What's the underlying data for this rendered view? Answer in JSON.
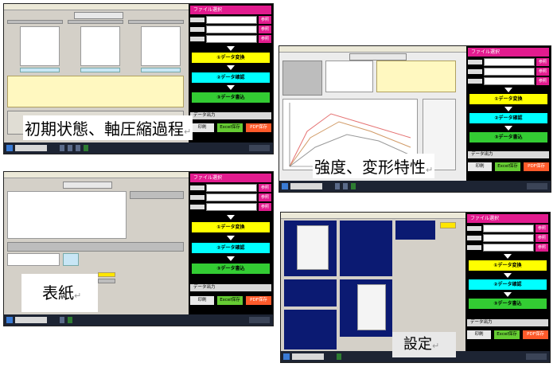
{
  "panel": {
    "file_select": "ファイル選択",
    "file_btn": "参照",
    "step1": "①データ変換",
    "step2": "②データ確認",
    "step3": "③データ書込",
    "output": "データ出力",
    "print": "印刷",
    "excel": "Excel保存",
    "pdf": "PDF保存"
  },
  "captions": {
    "initial": "初期状態、軸圧縮過程",
    "strength": "強度、変形特性",
    "cover": "表紙",
    "settings": "設定",
    "mark": "↵"
  },
  "colors": {
    "magenta": "#e21b8e",
    "yellow": "#ffff00",
    "cyan": "#00ffff",
    "green": "#33cc33",
    "excel": "#66cc33",
    "pdf": "#ff5a2a",
    "navy": "#0b1a72"
  }
}
